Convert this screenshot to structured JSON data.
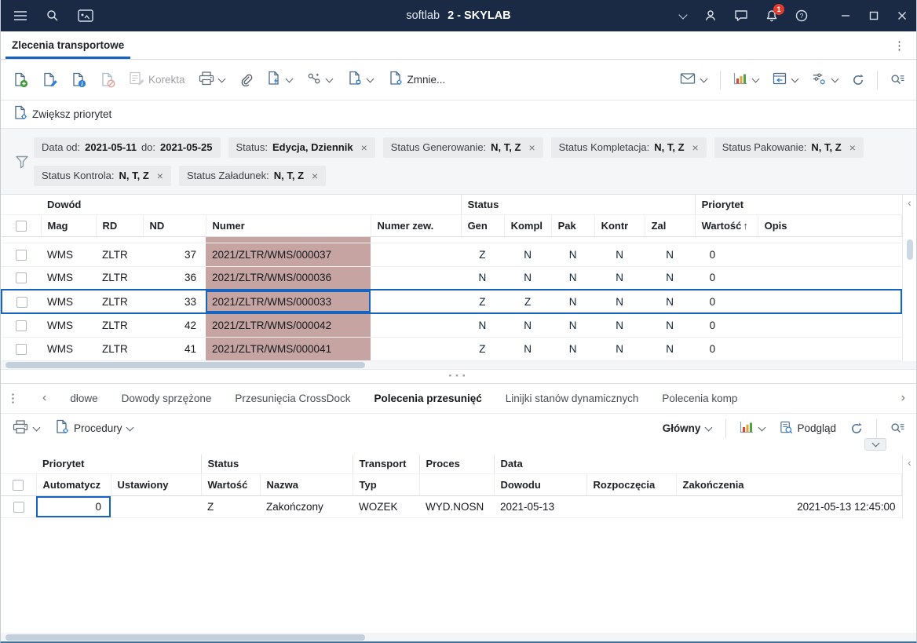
{
  "titlebar": {
    "app_name": "softlab",
    "session_label": "2 - SKYLAB",
    "notification_count": "1"
  },
  "page": {
    "main_tab": "Zlecenia transportowe"
  },
  "toolbar": {
    "korekta": "Korekta",
    "zmniejsz": "Zmnie...",
    "zwieksz_priorytet": "Zwiększ priorytet"
  },
  "filters": {
    "date": {
      "label": "Data od:",
      "from": "2021-05-11",
      "to_label": "do:",
      "to": "2021-05-25"
    },
    "chips": [
      {
        "label": "Status:",
        "value": "Edycja, Dziennik"
      },
      {
        "label": "Status Generowanie:",
        "value": "N, T, Z"
      },
      {
        "label": "Status Kompletacja:",
        "value": "N, T, Z"
      },
      {
        "label": "Status Pakowanie:",
        "value": "N, T, Z"
      },
      {
        "label": "Status Kontrola:",
        "value": "N, T, Z"
      },
      {
        "label": "Status Załadunek:",
        "value": "N, T, Z"
      }
    ]
  },
  "main_table": {
    "group_headers": {
      "dowod": "Dowód",
      "status": "Status",
      "priorytet": "Priorytet"
    },
    "columns": {
      "mag": "Mag",
      "rd": "RD",
      "nd": "ND",
      "numer": "Numer",
      "numer_zew": "Numer zew.",
      "gen": "Gen",
      "kompl": "Kompl",
      "pak": "Pak",
      "kontr": "Kontr",
      "zal": "Zal",
      "wartosc": "Wartość",
      "sort_indicator": "↑",
      "opis": "Opis"
    },
    "rows": [
      {
        "mag": "WMS",
        "rd": "ZLTR",
        "nd": "37",
        "numer": "2021/ZLTR/WMS/000037",
        "numer_zew": "",
        "gen": "Z",
        "kompl": "N",
        "pak": "N",
        "kontr": "N",
        "zal": "N",
        "wartosc": "0",
        "opis": ""
      },
      {
        "mag": "WMS",
        "rd": "ZLTR",
        "nd": "36",
        "numer": "2021/ZLTR/WMS/000036",
        "numer_zew": "",
        "gen": "N",
        "kompl": "N",
        "pak": "N",
        "kontr": "N",
        "zal": "N",
        "wartosc": "0",
        "opis": ""
      },
      {
        "mag": "WMS",
        "rd": "ZLTR",
        "nd": "33",
        "numer": "2021/ZLTR/WMS/000033",
        "numer_zew": "",
        "gen": "Z",
        "kompl": "Z",
        "pak": "N",
        "kontr": "N",
        "zal": "N",
        "wartosc": "0",
        "opis": "",
        "selected": true
      },
      {
        "mag": "WMS",
        "rd": "ZLTR",
        "nd": "42",
        "numer": "2021/ZLTR/WMS/000042",
        "numer_zew": "",
        "gen": "N",
        "kompl": "N",
        "pak": "N",
        "kontr": "N",
        "zal": "N",
        "wartosc": "0",
        "opis": ""
      },
      {
        "mag": "WMS",
        "rd": "ZLTR",
        "nd": "41",
        "numer": "2021/ZLTR/WMS/000041",
        "numer_zew": "",
        "gen": "Z",
        "kompl": "N",
        "pak": "N",
        "kontr": "N",
        "zal": "N",
        "wartosc": "0",
        "opis": ""
      }
    ]
  },
  "detail_tabs": {
    "items": [
      {
        "label": "dłowe"
      },
      {
        "label": "Dowody sprzężone"
      },
      {
        "label": "Przesunięcia CrossDock"
      },
      {
        "label": "Polecenia przesunięć",
        "active": true
      },
      {
        "label": "Linijki stanów dynamicznych"
      },
      {
        "label": "Polecenia komp"
      }
    ]
  },
  "detail_toolbar": {
    "procedury": "Procedury",
    "glowny": "Główny",
    "podglad": "Podgląd"
  },
  "detail_table": {
    "group_headers": {
      "priorytet": "Priorytet",
      "status": "Status",
      "transport": "Transport",
      "proces": "Proces",
      "data": "Data"
    },
    "columns": {
      "automatycz": "Automatycz",
      "ustawiony": "Ustawiony",
      "wartosc": "Wartość",
      "nazwa": "Nazwa",
      "typ": "Typ",
      "dowodu": "Dowodu",
      "rozpoczecia": "Rozpoczęcia",
      "zakonczenia": "Zakończenia"
    },
    "rows": [
      {
        "automatycz": "0",
        "ustawiony": "",
        "wartosc": "Z",
        "nazwa": "Zakończony",
        "typ": "WOZEK",
        "proces": "WYD.NOSN",
        "dowodu": "2021-05-13",
        "rozpoczecia": "",
        "zakonczenia": "2021-05-13 12:45:00"
      }
    ]
  },
  "colors": {
    "titlebar_bg": "#1b2a44",
    "accent": "#1565c0",
    "status_n": "#5bc2ee",
    "status_z": "#8a90d6",
    "numer_cell": "#c5a4a2",
    "badge": "#e13c2f"
  }
}
